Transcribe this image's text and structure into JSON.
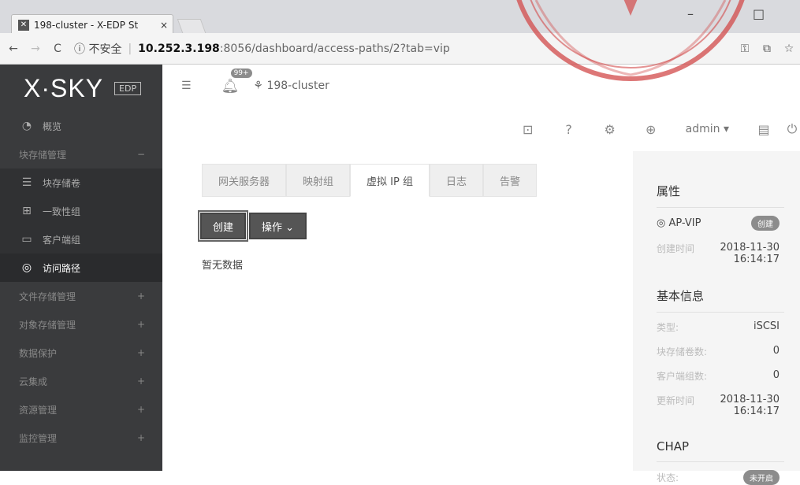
{
  "browser": {
    "tab_title": "198-cluster - X-EDP St",
    "tab_close": "×",
    "security_label": "ⓘ 不安全",
    "url_host": "10.252.3.198",
    "url_path": ":8056/dashboard/access-paths/2?tab=vip"
  },
  "brand": {
    "logo": "X·SKY",
    "badge": "EDP"
  },
  "sidebar": {
    "items": [
      {
        "label": "概览",
        "icon": "dashboard-icon"
      },
      {
        "label": "块存储管理",
        "suffix": "−"
      },
      {
        "label": "块存储卷",
        "icon": "database-icon"
      },
      {
        "label": "一致性组",
        "icon": "group-icon"
      },
      {
        "label": "客户端组",
        "icon": "client-group-icon"
      },
      {
        "label": "访问路径",
        "icon": "target-icon"
      },
      {
        "label": "文件存储管理",
        "suffix": "+"
      },
      {
        "label": "对象存储管理",
        "suffix": "+"
      },
      {
        "label": "数据保护",
        "suffix": "+"
      },
      {
        "label": "云集成",
        "suffix": "+"
      },
      {
        "label": "资源管理",
        "suffix": "+"
      },
      {
        "label": "监控管理",
        "suffix": "+"
      }
    ]
  },
  "header": {
    "notif_count": "99+",
    "cluster_name": "198-cluster",
    "user": "admin ▾"
  },
  "tabs": [
    "网关服务器",
    "映射组",
    "虚拟 IP 组",
    "日志",
    "告警"
  ],
  "active_tab": 2,
  "actions": {
    "create": "创建",
    "operate": "操作 ⌄"
  },
  "empty_text": "暂无数据",
  "properties": {
    "title": "属性",
    "name": "AP-VIP",
    "status_badge": "创建",
    "created_key": "创建时间",
    "created_date": "2018-11-30",
    "created_time": "16:14:17"
  },
  "basic_info": {
    "title": "基本信息",
    "rows": [
      {
        "k": "类型:",
        "v": "iSCSI"
      },
      {
        "k": "块存储卷数:",
        "v": "0"
      },
      {
        "k": "客户端组数:",
        "v": "0"
      }
    ],
    "updated_key": "更新时间",
    "updated_date": "2018-11-30",
    "updated_time": "16:14:17"
  },
  "chap": {
    "title": "CHAP",
    "status_key": "状态:",
    "status_value": "未开启"
  }
}
